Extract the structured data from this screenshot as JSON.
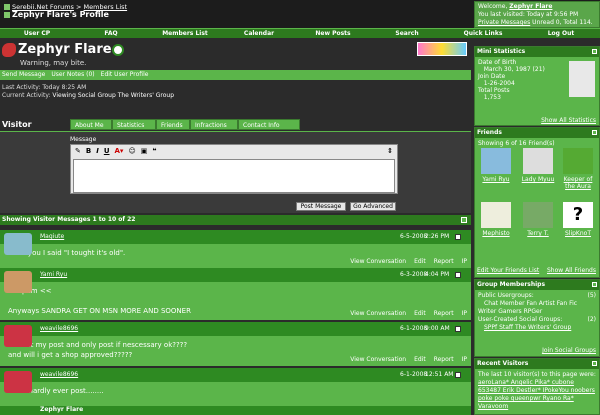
{
  "header": {
    "crumbs": [
      "Serebii.Net Forums",
      ">",
      "Members List"
    ],
    "current": "Zephyr Flare's Profile",
    "welcome_prefix": "Welcome,",
    "welcome_name": "Zephyr Flare",
    "last_visit": "You last visited: Today at 9:56 PM",
    "pm_label": "Private Messages",
    "pm_status": "Unread 0, Total 114."
  },
  "nav": [
    "User CP",
    "FAQ",
    "Members List",
    "Calendar",
    "New Posts",
    "Search",
    "Quick Links",
    "Log Out"
  ],
  "profile": {
    "name": "Zephyr Flare",
    "title": "Warning, may bite.",
    "actions": [
      "Send Message",
      "User Notes (0)",
      "Edit User Profile"
    ],
    "last_activity_label": "Last Activity:",
    "last_activity": "Today 8:25 AM",
    "current_activity_label": "Current Activity:",
    "current_activity": "Viewing Social Group",
    "current_activity_group": "The Writers' Group"
  },
  "tabs": [
    "Visitor Messages",
    "About Me",
    "Statistics",
    "Friends",
    "Infractions",
    "Contact Info"
  ],
  "editor": {
    "label": "Message",
    "post_button": "Post Message",
    "advanced_button": "Go Advanced"
  },
  "vm_header": "Showing Visitor Messages 1 to 10 of 22",
  "messages": [
    {
      "user": "Magiute",
      "date": "6-5-2008",
      "time": "2:26 PM",
      "text": "I told you I said \"I tought it's old\".",
      "links": [
        "View Conversation",
        "Edit",
        "Report",
        "IP"
      ]
    },
    {
      "user": "Yami Ryu",
      "date": "6-3-2008",
      "time": "4:04 PM",
      "text": "lol spam <<",
      "text2": "Anyways SANDRA GET ON MSN MORE AND SOONER",
      "links": [
        "View Conversation",
        "Edit",
        "Report",
        "IP"
      ]
    },
    {
      "user": "weavile8696",
      "date": "6-1-2008",
      "time": "9:00 AM",
      "text": "i'll limit my post and only post if nescessary ok????",
      "text2": "and will i get a shop approved?????",
      "links": [
        "View Conversation",
        "Edit",
        "Report",
        "IP"
      ]
    },
    {
      "user": "weavile8696",
      "date": "6-1-2008",
      "time": "12:51 AM",
      "text": "ok i'll hardly ever post........",
      "links": [
        "View Conversation",
        "Edit",
        "Report",
        "IP"
      ]
    },
    {
      "user": "Zephyr Flare"
    }
  ],
  "sidebar": {
    "mini_stats": {
      "title": "Mini Statistics",
      "dob_label": "Date of Birth",
      "dob": "March 30, 1987 (21)",
      "join_label": "Join Date",
      "join": "1-26-2004",
      "posts_label": "Total Posts",
      "posts": "1,753",
      "footer": "Show All Statistics"
    },
    "friends": {
      "title": "Friends",
      "showing": "Showing 6 of 16 Friend(s)",
      "list": [
        "Yami Ryu",
        "Lady Myuu",
        "Keeper of the Aura",
        "Mephisto",
        "Terry T.",
        "SlipKnoT"
      ],
      "edit": "Edit Your Friends List",
      "show_all": "Show All Friends"
    },
    "groups": {
      "title": "Group Memberships",
      "public_label": "Public Usergroups:",
      "public_count": "(5)",
      "public": "Chat Member  Fan Artist  Fan Fic Writer  Gamers  RPGer",
      "created_label": "User-Created Social Groups:",
      "created_count": "(2)",
      "created": "SPPf Staff  The Writers' Group",
      "footer": "Join Social Groups"
    },
    "visitors": {
      "title": "Recent Visitors",
      "text": "The last 10 visitor(s) to this page were:",
      "names": "aeroLana* Angelic Pika* cubone 653487 Erik Destler* IPokeYou noobers poke poke queenpwr Ryano Ra* Varavoom"
    }
  },
  "colors": {
    "nav_green": "#2d7a1e",
    "light_green": "#5bb54a",
    "bg": "#2b2b2b"
  }
}
